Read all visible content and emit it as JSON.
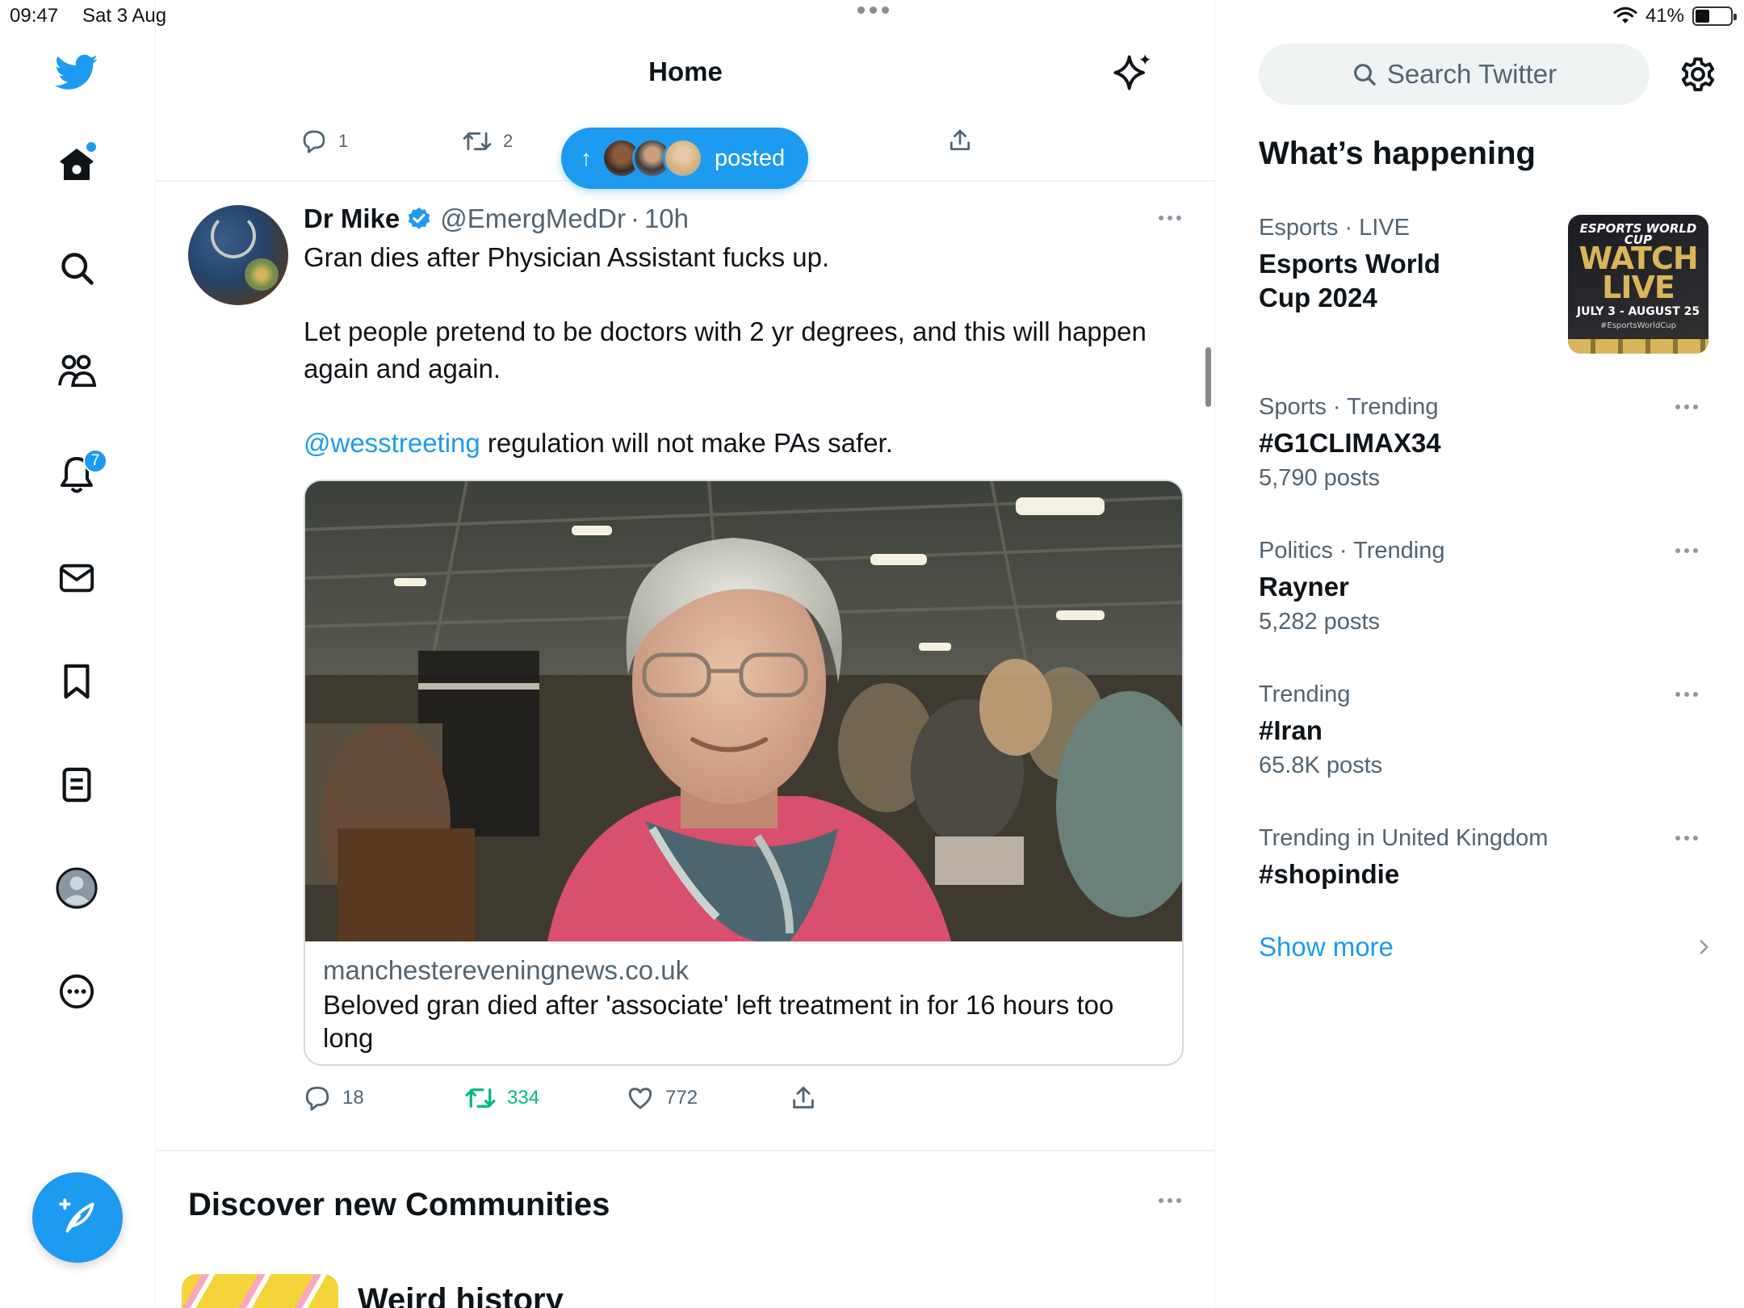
{
  "status_bar": {
    "time": "09:47",
    "date": "Sat 3 Aug",
    "battery": "41%",
    "battery_level": 0.41
  },
  "nav": {
    "notifications_badge": "7",
    "items": [
      {
        "name": "twitter-logo-icon"
      },
      {
        "name": "home-icon"
      },
      {
        "name": "search-icon"
      },
      {
        "name": "communities-icon"
      },
      {
        "name": "notifications-icon"
      },
      {
        "name": "messages-icon"
      },
      {
        "name": "bookmarks-icon"
      },
      {
        "name": "lists-icon"
      },
      {
        "name": "profile-icon"
      },
      {
        "name": "more-icon"
      }
    ],
    "compose_icon": "compose-feather-icon"
  },
  "main": {
    "title": "Home",
    "prev_tweet": {
      "replies": "1",
      "retweets": "2"
    },
    "new_posts_pill": {
      "label": "posted"
    },
    "tweet": {
      "name": "Dr Mike",
      "handle": "@EmergMedDr",
      "separator": "·",
      "time": "10h",
      "line1": "Gran dies after Physician Assistant fucks up.",
      "line2": "Let people pretend to be doctors with 2 yr degrees, and this will happen again and again.",
      "mention": "@wesstreeting",
      "line3_rest": " regulation will not make PAs safer.",
      "card": {
        "domain": "manchestereveningnews.co.uk",
        "title": "Beloved gran died after 'associate' left treatment in for 16 hours too long"
      },
      "replies": "18",
      "retweets": "334",
      "likes": "772"
    },
    "discover": {
      "title": "Discover new Communities",
      "community_name": "Weird history"
    }
  },
  "sidebar": {
    "search_placeholder": "Search Twitter",
    "whats_happening": "What’s happening",
    "trends": [
      {
        "category": "Esports",
        "context": "LIVE",
        "name": "Esports World Cup 2024",
        "name_line1": "Esports World",
        "name_line2": "Cup 2024"
      },
      {
        "category": "Sports · Trending",
        "name": "#G1CLIMAX34",
        "count": "5,790 posts"
      },
      {
        "category": "Politics · Trending",
        "name": "Rayner",
        "count": "5,282 posts"
      },
      {
        "category": "Trending",
        "name": "#Iran",
        "count": "65.8K posts"
      },
      {
        "category": "Trending in United Kingdom",
        "name": "#shopindie"
      }
    ],
    "esports_image": {
      "top": "ESPORTS WORLD CUP",
      "headline_1": "WATCH",
      "headline_2": "LIVE",
      "dates": "JULY 3 - AUGUST 25",
      "hashtag": "#EsportsWorldCup"
    },
    "show_more": "Show more"
  },
  "colors": {
    "accent": "#1d9bf0",
    "retweet_active": "#00ba7c",
    "secondary_text": "#536471",
    "primary_text": "#0f1419"
  }
}
